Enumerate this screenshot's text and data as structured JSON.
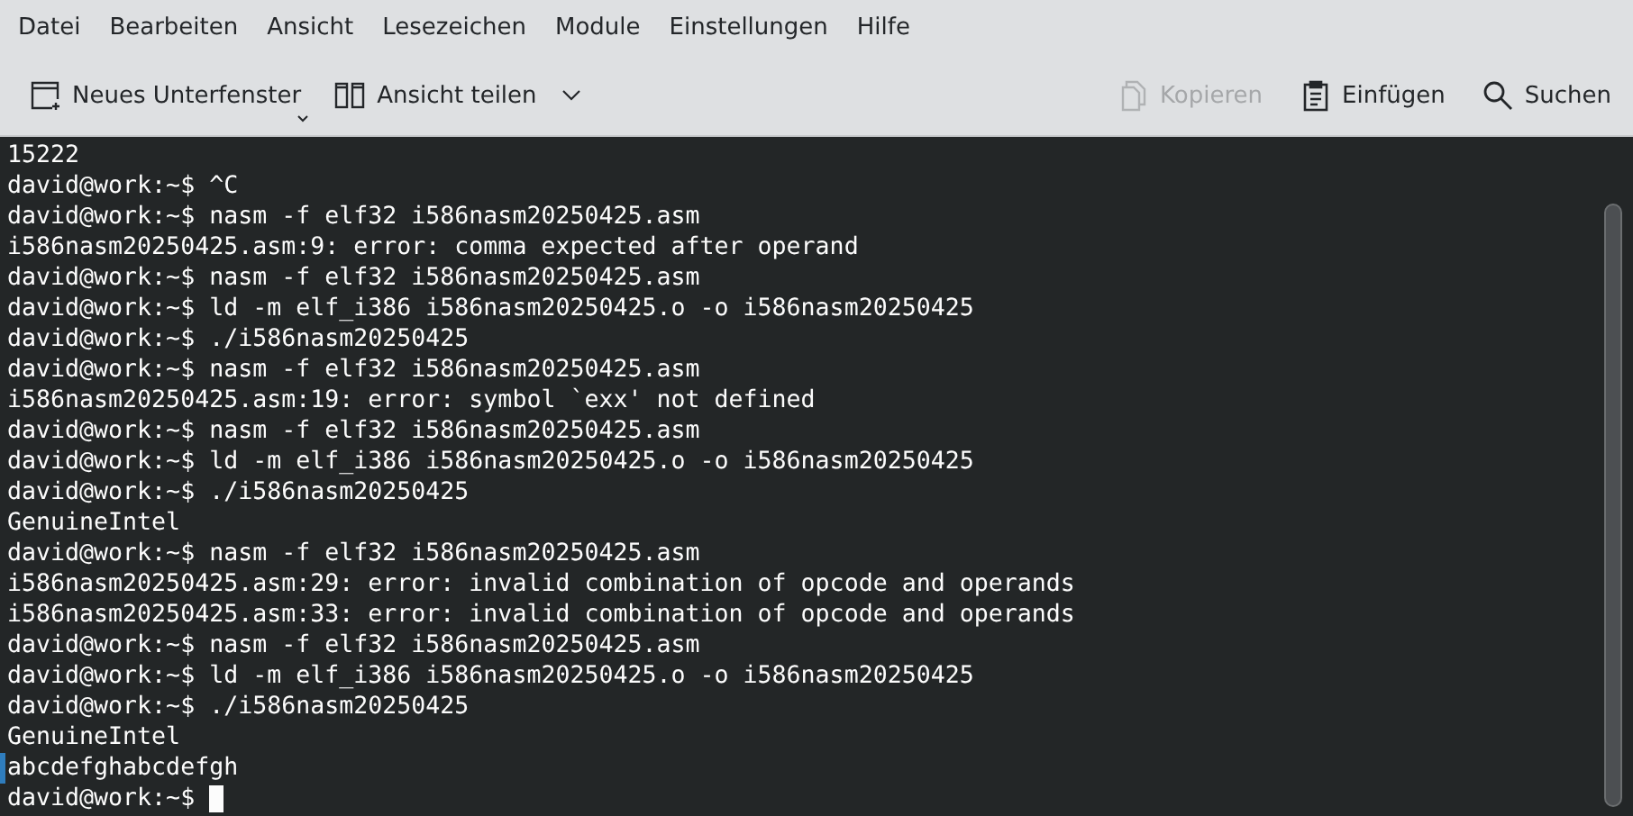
{
  "menu": [
    "Datei",
    "Bearbeiten",
    "Ansicht",
    "Lesezeichen",
    "Module",
    "Einstellungen",
    "Hilfe"
  ],
  "toolbar": [
    {
      "kind": "new-tab",
      "label": "Neues Unterfenster",
      "disabled": false
    },
    {
      "kind": "split",
      "label": "Ansicht teilen",
      "disabled": false
    },
    {
      "kind": "copy",
      "label": "Kopieren",
      "disabled": true
    },
    {
      "kind": "paste",
      "label": "Einfügen",
      "disabled": false
    },
    {
      "kind": "search",
      "label": "Suchen",
      "disabled": false
    }
  ],
  "terminal": {
    "lines": [
      {
        "text": "15222",
        "marked": false
      },
      {
        "text": "david@work:~$ ^C",
        "marked": false
      },
      {
        "text": "david@work:~$ nasm -f elf32 i586nasm20250425.asm",
        "marked": false
      },
      {
        "text": "i586nasm20250425.asm:9: error: comma expected after operand",
        "marked": false
      },
      {
        "text": "david@work:~$ nasm -f elf32 i586nasm20250425.asm",
        "marked": false
      },
      {
        "text": "david@work:~$ ld -m elf_i386 i586nasm20250425.o -o i586nasm20250425",
        "marked": false
      },
      {
        "text": "david@work:~$ ./i586nasm20250425",
        "marked": false
      },
      {
        "text": "david@work:~$ nasm -f elf32 i586nasm20250425.asm",
        "marked": false
      },
      {
        "text": "i586nasm20250425.asm:19: error: symbol `exx' not defined",
        "marked": false
      },
      {
        "text": "david@work:~$ nasm -f elf32 i586nasm20250425.asm",
        "marked": false
      },
      {
        "text": "david@work:~$ ld -m elf_i386 i586nasm20250425.o -o i586nasm20250425",
        "marked": false
      },
      {
        "text": "david@work:~$ ./i586nasm20250425",
        "marked": false
      },
      {
        "text": "GenuineIntel",
        "marked": false
      },
      {
        "text": "david@work:~$ nasm -f elf32 i586nasm20250425.asm",
        "marked": false
      },
      {
        "text": "i586nasm20250425.asm:29: error: invalid combination of opcode and operands",
        "marked": false
      },
      {
        "text": "i586nasm20250425.asm:33: error: invalid combination of opcode and operands",
        "marked": false
      },
      {
        "text": "david@work:~$ nasm -f elf32 i586nasm20250425.asm",
        "marked": false
      },
      {
        "text": "david@work:~$ ld -m elf_i386 i586nasm20250425.o -o i586nasm20250425",
        "marked": false
      },
      {
        "text": "david@work:~$ ./i586nasm20250425",
        "marked": false
      },
      {
        "text": "GenuineIntel",
        "marked": false
      },
      {
        "text": "abcdefghabcdefgh",
        "marked": true
      },
      {
        "text": "david@work:~$",
        "marked": false
      }
    ],
    "cursor": true
  }
}
